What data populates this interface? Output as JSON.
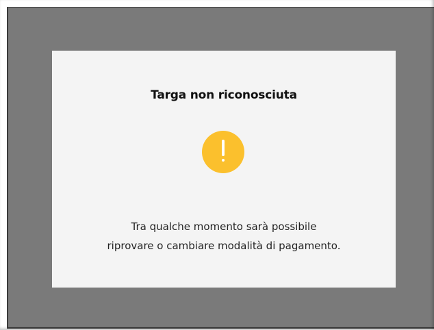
{
  "dialog": {
    "title": "Targa non riconosciuta",
    "icon": "warning-icon",
    "icon_color": "#fbc02d",
    "message_line1": "Tra qualche momento sarà possibile",
    "message_line2": "riprovare o cambiare modalità di pagamento."
  },
  "colors": {
    "overlay": "#7a7a7a",
    "dialog_background": "#f4f4f4"
  }
}
